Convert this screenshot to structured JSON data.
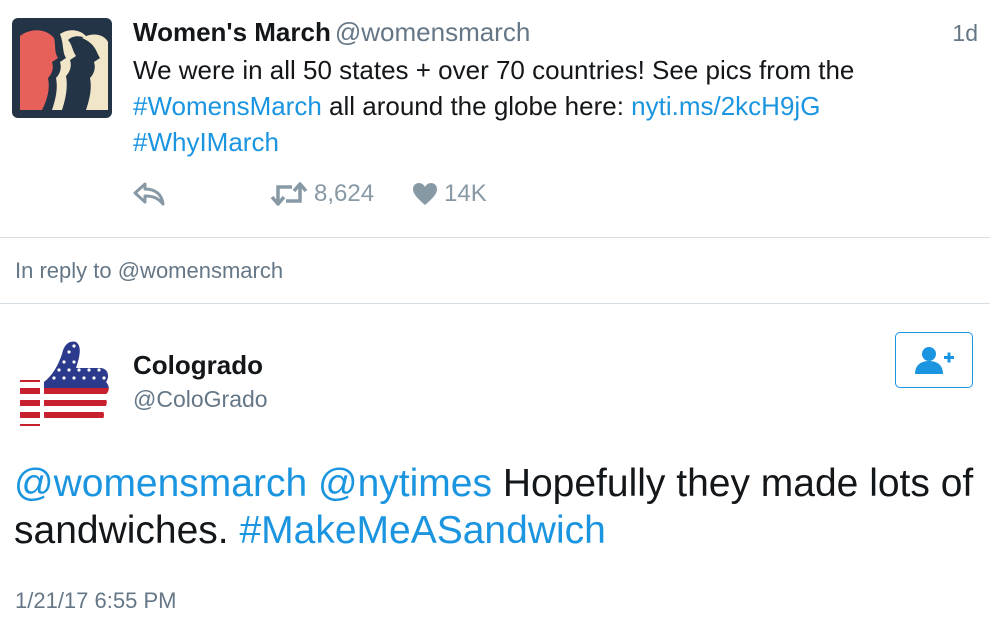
{
  "tweet1": {
    "author_name": "Women's March",
    "author_handle": "@womensmarch",
    "time": "1d",
    "text": {
      "part1": "We were in all 50 states + over 70 countries! See pics from the ",
      "hashtag1": "#WomensMarch",
      "part2": " all around the globe here: ",
      "link": "nyti.ms/2kcH9jG",
      "hashtag2": "#WhyIMarch"
    },
    "retweet_count": "8,624",
    "like_count": "14K",
    "icons": {
      "reply": "reply-icon",
      "retweet": "retweet-icon",
      "like": "heart-icon"
    }
  },
  "reply_context": "In reply to @womensmarch",
  "tweet2": {
    "author_name": "Colograd​o",
    "author_handle": "@ColoGrado",
    "text": {
      "mention1": "@womensmarch",
      "mention2": "@nytimes",
      "body": " Hopefully they made lots of sandwiches. ",
      "hashtag": "#MakeMeASandwich"
    },
    "date": "1/21/17 6:55 PM",
    "follow_icon": "add-user-icon"
  },
  "colors": {
    "link": "#1b95e0",
    "secondary_text": "#657786",
    "action_icon": "#8899a6",
    "divider": "#d6dde3",
    "avatar1_bg": "#243447",
    "avatar1_red": "#e8605a",
    "avatar1_cream": "#f2e6c9"
  }
}
